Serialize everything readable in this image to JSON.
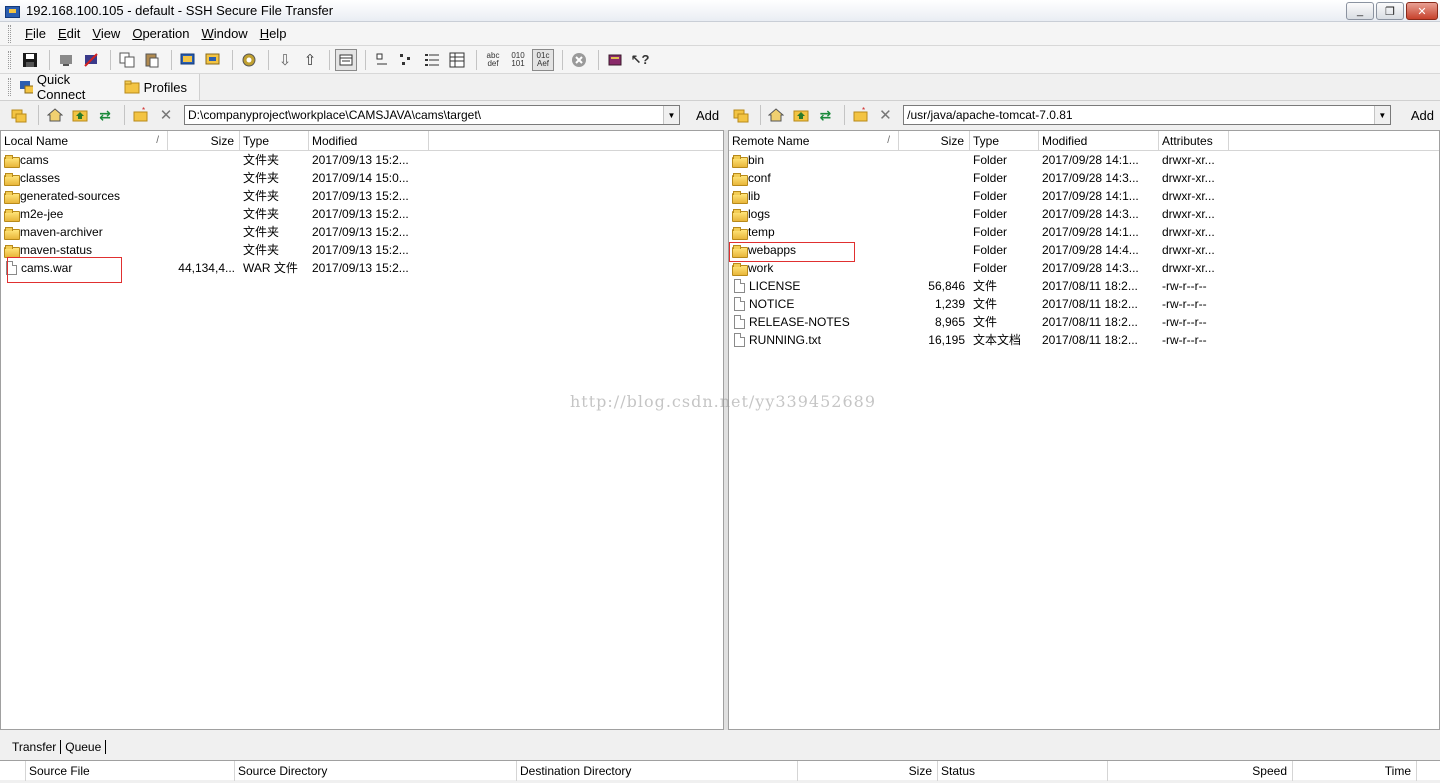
{
  "window": {
    "title": "192.168.100.105 - default - SSH Secure File Transfer",
    "minimize": "_",
    "restore": "❐",
    "close": "✕"
  },
  "menu": [
    {
      "label": "File",
      "u": "F",
      "rest": "ile"
    },
    {
      "label": "Edit",
      "u": "E",
      "rest": "dit"
    },
    {
      "label": "View",
      "u": "V",
      "rest": "iew"
    },
    {
      "label": "Operation",
      "u": "O",
      "rest": "peration"
    },
    {
      "label": "Window",
      "u": "W",
      "rest": "indow"
    },
    {
      "label": "Help",
      "u": "H",
      "rest": "elp"
    }
  ],
  "quickbar": {
    "quick_connect": "Quick Connect",
    "profiles": "Profiles"
  },
  "local": {
    "path": "D:\\companyproject\\workplace\\CAMSJAVA\\cams\\target\\",
    "add_label": "Add",
    "columns": {
      "name": "Local Name",
      "sort": "/",
      "size": "Size",
      "type": "Type",
      "modified": "Modified"
    },
    "rows": [
      {
        "kind": "folder",
        "name": "cams",
        "size": "",
        "type": "文件夹",
        "modified": "2017/09/13 15:2..."
      },
      {
        "kind": "folder",
        "name": "classes",
        "size": "",
        "type": "文件夹",
        "modified": "2017/09/14 15:0..."
      },
      {
        "kind": "folder",
        "name": "generated-sources",
        "size": "",
        "type": "文件夹",
        "modified": "2017/09/13 15:2..."
      },
      {
        "kind": "folder",
        "name": "m2e-jee",
        "size": "",
        "type": "文件夹",
        "modified": "2017/09/13 15:2..."
      },
      {
        "kind": "folder",
        "name": "maven-archiver",
        "size": "",
        "type": "文件夹",
        "modified": "2017/09/13 15:2..."
      },
      {
        "kind": "folder",
        "name": "maven-status",
        "size": "",
        "type": "文件夹",
        "modified": "2017/09/13 15:2..."
      },
      {
        "kind": "file",
        "name": "cams.war",
        "size": "44,134,4...",
        "type": "WAR 文件",
        "modified": "2017/09/13 15:2..."
      }
    ]
  },
  "remote": {
    "path": "/usr/java/apache-tomcat-7.0.81",
    "add_label": "Add",
    "columns": {
      "name": "Remote Name",
      "sort": "/",
      "size": "Size",
      "type": "Type",
      "modified": "Modified",
      "attributes": "Attributes"
    },
    "rows": [
      {
        "kind": "folder",
        "name": "bin",
        "size": "",
        "type": "Folder",
        "modified": "2017/09/28 14:1...",
        "attributes": "drwxr-xr..."
      },
      {
        "kind": "folder",
        "name": "conf",
        "size": "",
        "type": "Folder",
        "modified": "2017/09/28 14:3...",
        "attributes": "drwxr-xr..."
      },
      {
        "kind": "folder",
        "name": "lib",
        "size": "",
        "type": "Folder",
        "modified": "2017/09/28 14:1...",
        "attributes": "drwxr-xr..."
      },
      {
        "kind": "folder",
        "name": "logs",
        "size": "",
        "type": "Folder",
        "modified": "2017/09/28 14:3...",
        "attributes": "drwxr-xr..."
      },
      {
        "kind": "folder",
        "name": "temp",
        "size": "",
        "type": "Folder",
        "modified": "2017/09/28 14:1...",
        "attributes": "drwxr-xr..."
      },
      {
        "kind": "folder",
        "name": "webapps",
        "size": "",
        "type": "Folder",
        "modified": "2017/09/28 14:4...",
        "attributes": "drwxr-xr..."
      },
      {
        "kind": "folder",
        "name": "work",
        "size": "",
        "type": "Folder",
        "modified": "2017/09/28 14:3...",
        "attributes": "drwxr-xr..."
      },
      {
        "kind": "file",
        "name": "LICENSE",
        "size": "56,846",
        "type": "文件",
        "modified": "2017/08/11 18:2...",
        "attributes": "-rw-r--r--"
      },
      {
        "kind": "file",
        "name": "NOTICE",
        "size": "1,239",
        "type": "文件",
        "modified": "2017/08/11 18:2...",
        "attributes": "-rw-r--r--"
      },
      {
        "kind": "file",
        "name": "RELEASE-NOTES",
        "size": "8,965",
        "type": "文件",
        "modified": "2017/08/11 18:2...",
        "attributes": "-rw-r--r--"
      },
      {
        "kind": "file",
        "name": "RUNNING.txt",
        "size": "16,195",
        "type": "文本文档",
        "modified": "2017/08/11 18:2...",
        "attributes": "-rw-r--r--"
      }
    ]
  },
  "watermark": "http://blog.csdn.net/yy339452689",
  "bottom": {
    "tabs": [
      "Transfer",
      "Queue"
    ],
    "columns": [
      "Source File",
      "Source Directory",
      "Destination Directory",
      "Size",
      "Status",
      "Speed",
      "Time"
    ]
  },
  "icons": {
    "toolbar": [
      "save-icon",
      "connect-icon",
      "disconnect-icon",
      "copy-icon",
      "paste-icon",
      "new-terminal-icon",
      "new-file-transfer-icon",
      "settings-icon",
      "download-icon",
      "upload-icon",
      "view-icon",
      "large-icons-icon",
      "small-icons-icon",
      "list-icon",
      "details-icon",
      "ascii-icon",
      "binary-icon",
      "auto-icon",
      "stop-icon",
      "help-book-icon",
      "whats-this-icon"
    ]
  }
}
